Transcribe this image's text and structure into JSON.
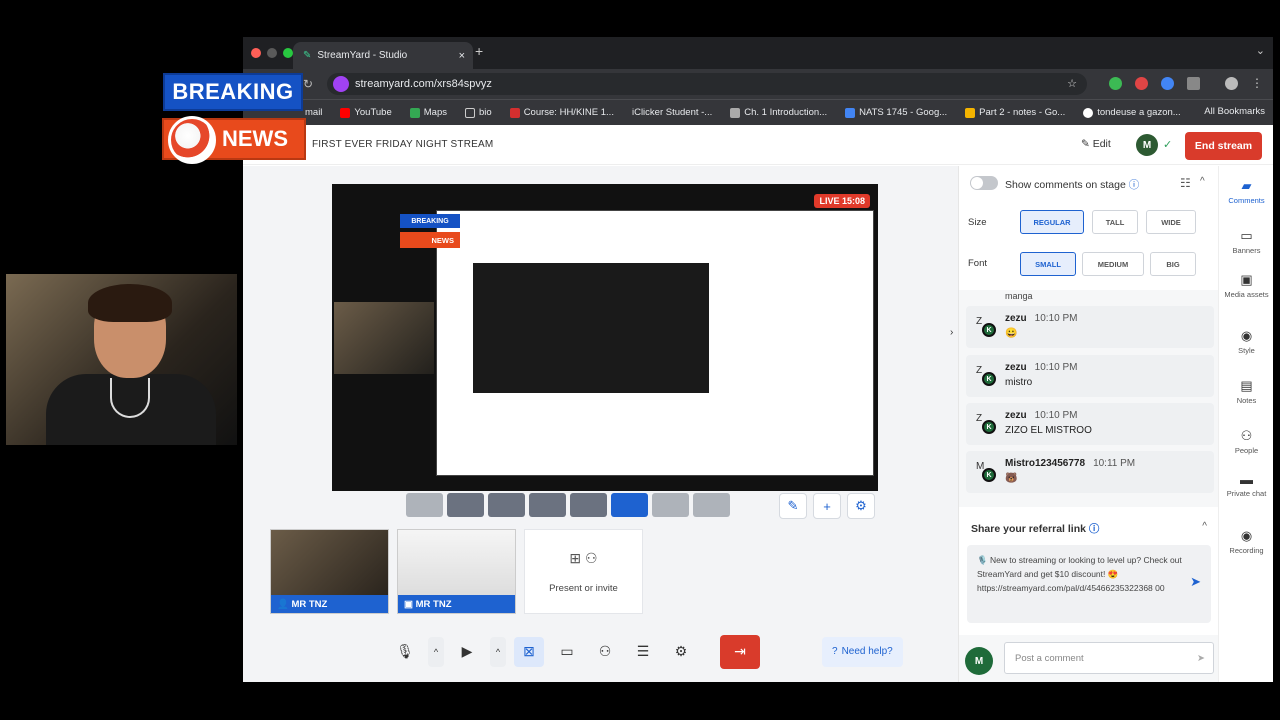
{
  "overlay": {
    "breaking": "BREAKING",
    "news": "NEWS"
  },
  "browser": {
    "tab_title": "StreamYard - Studio",
    "url": "streamyard.com/xrs84spvyz",
    "bookmarks": [
      "mail",
      "YouTube",
      "Maps",
      "bio",
      "Course: HH/KINE 1...",
      "iClicker Student -...",
      "Ch. 1 Introduction...",
      "NATS 1745 - Goog...",
      "Part 2 - notes - Go...",
      "tondeuse a gazon..."
    ],
    "all_bookmarks": "All Bookmarks"
  },
  "header": {
    "stream_title": "FIRST EVER FRIDAY NIGHT STREAM",
    "edit": "Edit",
    "end_stream": "End stream",
    "avatar_initial": "M"
  },
  "stage": {
    "live_timer": "LIVE 15:08",
    "inner_breaking": "BREAKING",
    "inner_news": "NEWS"
  },
  "participants": [
    {
      "label": "MR TNZ",
      "kind": "camera"
    },
    {
      "label": "MR TNZ",
      "kind": "screen"
    }
  ],
  "present": {
    "label": "Present or invite"
  },
  "needhelp": "Need help?",
  "comments_panel": {
    "show_on_stage": "Show comments on stage",
    "size_label": "Size",
    "size_opts": [
      "REGULAR",
      "TALL",
      "WIDE"
    ],
    "font_label": "Font",
    "font_opts": [
      "SMALL",
      "MEDIUM",
      "BIG"
    ],
    "partial_text": "manga",
    "comments": [
      {
        "name": "zezu",
        "time": "10:10 PM",
        "text": "😀"
      },
      {
        "name": "zezu",
        "time": "10:10 PM",
        "text": "mistro"
      },
      {
        "name": "zezu",
        "time": "10:10 PM",
        "text": "ZIZO EL MISTROO"
      },
      {
        "name": "Mistro123456778",
        "time": "10:11 PM",
        "text": "🐻"
      }
    ],
    "referral_title": "Share your referral link",
    "referral_text": "🎙️ New to streaming or looking to level up? Check out StreamYard and get $10 discount! 😍 https://streamyard.com/pal/d/45466235322368 00",
    "post_placeholder": "Post a comment"
  },
  "rail": [
    "Comments",
    "Banners",
    "Media assets",
    "Style",
    "Notes",
    "People",
    "Private chat",
    "Recording"
  ]
}
